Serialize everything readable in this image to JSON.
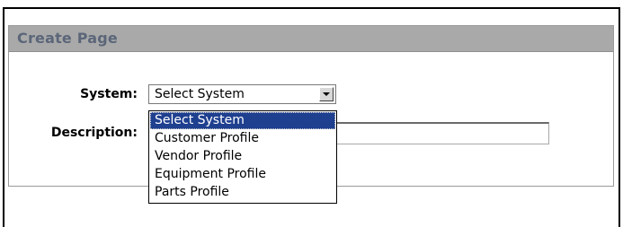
{
  "panel": {
    "title": "Create Page"
  },
  "form": {
    "system_label": "System:",
    "system_value": "Select System",
    "description_label": "Description:",
    "description_value": ""
  },
  "dropdown": {
    "options": [
      {
        "label": "Select System",
        "selected": true
      },
      {
        "label": "Customer Profile",
        "selected": false
      },
      {
        "label": "Vendor Profile",
        "selected": false
      },
      {
        "label": "Equipment Profile",
        "selected": false
      },
      {
        "label": "Parts Profile",
        "selected": false
      }
    ]
  },
  "icons": {
    "dropdown_button": "chevron-down-icon"
  },
  "colors": {
    "header_bg": "#a9a9a9",
    "title_text": "#5b6679",
    "selected_option_bg": "#1f3f8f"
  }
}
